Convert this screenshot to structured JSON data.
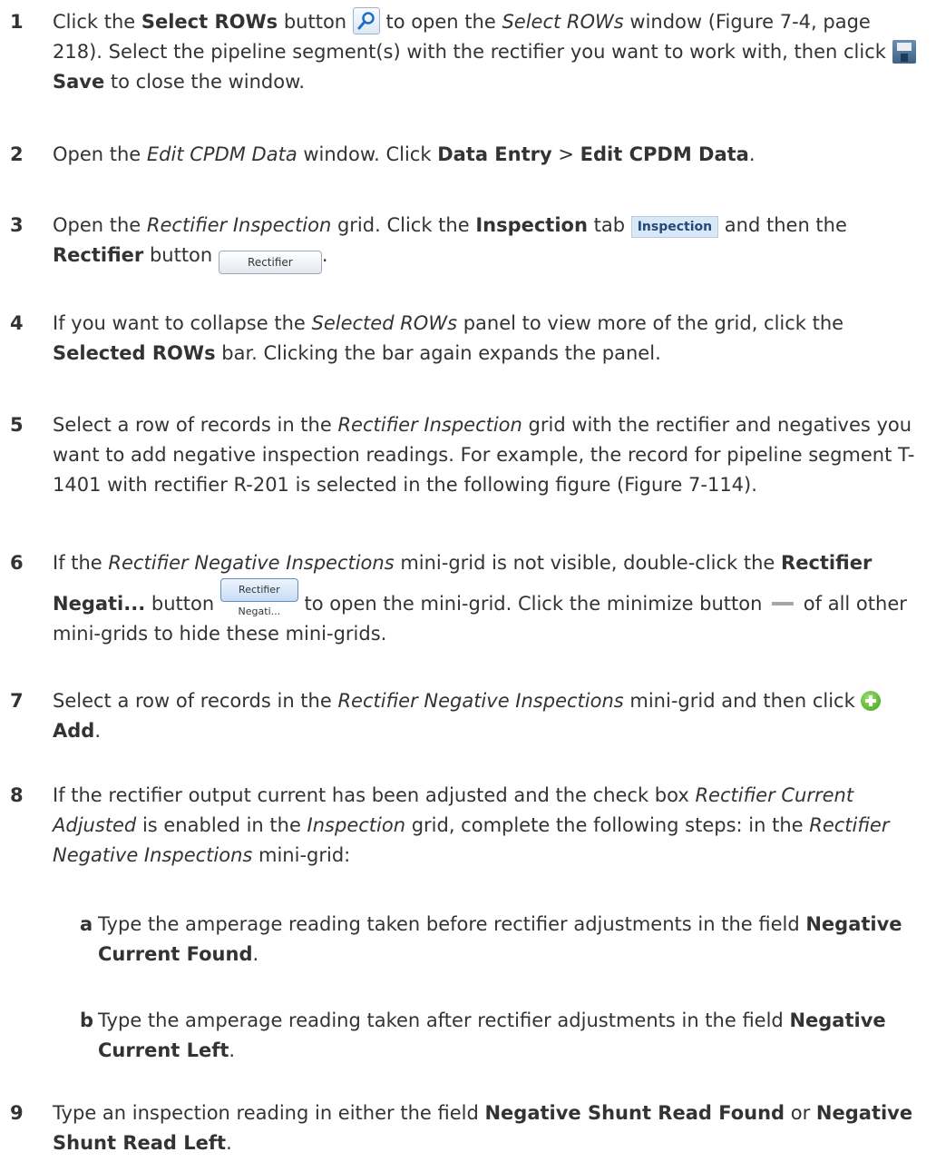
{
  "steps": [
    {
      "num": "1",
      "parts": {
        "a": "Click the ",
        "b": "Select ROWs",
        "c": " button ",
        "d": " to open the ",
        "e": "Select ROWs",
        "f": " window (Figure 7-4, page 218). Select the pipeline segment(s) with the rectifier you want to work with, then click ",
        "g": "Save",
        "h": " to close the window."
      }
    },
    {
      "num": "2",
      "parts": {
        "a": "Open the ",
        "b": "Edit CPDM Data",
        "c": " window. Click ",
        "d": "Data Entry",
        "e": " > ",
        "f": "Edit CPDM Data",
        "g": "."
      }
    },
    {
      "num": "3",
      "parts": {
        "a": "Open the ",
        "b": "Rectifier Inspection",
        "c": " grid. Click the ",
        "d": "Inspection",
        "e": " tab ",
        "f": " and then the ",
        "g": "Rectifier",
        "h": " button ",
        "i": "."
      }
    },
    {
      "num": "4",
      "parts": {
        "a": "If you want to collapse the ",
        "b": "Selected ROWs",
        "c": " panel to view more of the grid, click the ",
        "d": "Selected ROWs",
        "e": " bar. Clicking the bar again expands the panel."
      }
    },
    {
      "num": "5",
      "parts": {
        "a": "Select a row of records in the ",
        "b": "Rectifier Inspection",
        "c": " grid with the rectifier and negatives you want to add negative inspection readings. For example, the record for pipeline segment T-1401 with rectifier R-201 is selected in the following figure (Figure 7-114)."
      }
    },
    {
      "num": "6",
      "parts": {
        "a": "If the ",
        "b": "Rectifier Negative Inspections",
        "c": " mini-grid is not visible, double-click the ",
        "d": "Rectifier Negati...",
        "e": " button ",
        "f": " to open the mini-grid. Click the minimize button ",
        "g": " of all other mini-grids to hide these mini-grids."
      }
    },
    {
      "num": "7",
      "parts": {
        "a": "Select a row of records in the ",
        "b": "Rectifier Negative Inspections",
        "c": " mini-grid and then click ",
        "d": "Add",
        "e": "."
      }
    },
    {
      "num": "8",
      "parts": {
        "a": "If the rectifier output current has been adjusted and the check box ",
        "b": "Rectifier Current Adjusted",
        "c": " is enabled in the ",
        "d": "Inspection",
        "e": " grid, complete the following steps: in the ",
        "f": "Rectifier Negative Inspections",
        "g": " mini-grid:"
      }
    },
    {
      "num": "a",
      "parts": {
        "a": "Type the amperage reading taken before rectifier adjustments in the field ",
        "b": "Negative Current Found",
        "c": "."
      }
    },
    {
      "num": "b",
      "parts": {
        "a": "Type the amperage reading taken after rectifier adjustments in the field ",
        "b": "Negative Current Left",
        "c": "."
      }
    },
    {
      "num": "9",
      "parts": {
        "a": "Type an inspection reading in either the field ",
        "b": "Negative Shunt Read Found",
        "c": " or ",
        "d": "Negative Shunt Read Left",
        "e": "."
      }
    }
  ],
  "ui": {
    "inspection_tab_label": "Inspection",
    "rectifier_button_label": "Rectifier",
    "rectifier_negati_button_label": "Rectifier Negati..."
  },
  "colors": {
    "text": "#333333",
    "tab_bg": "#d9e8f7",
    "tab_text": "#244a7a",
    "add_green": "#3f9d1e",
    "button_border": "#5f8fc4"
  }
}
